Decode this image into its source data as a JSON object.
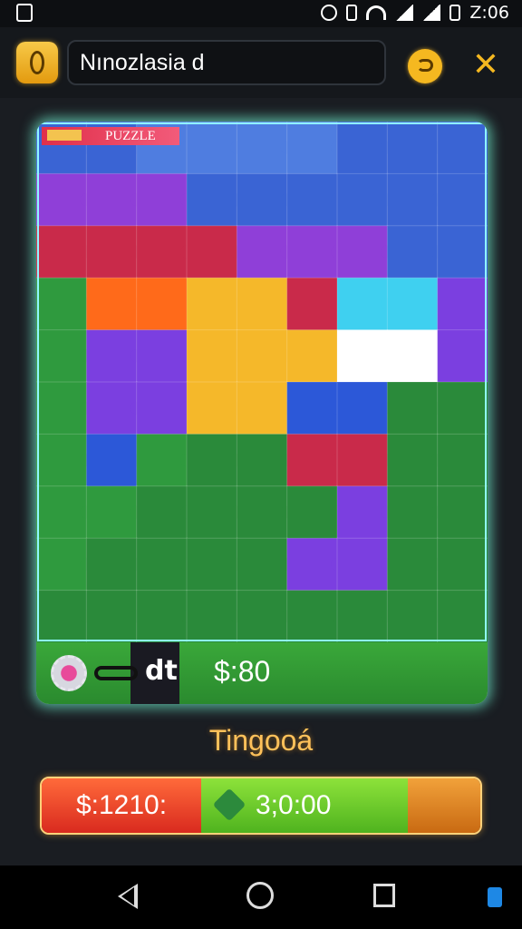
{
  "status_bar": {
    "time": "Z:06"
  },
  "header": {
    "title": "Nınozlasia d"
  },
  "board": {
    "tab_label": "PUZZLE",
    "footer": {
      "chain_text": "dt",
      "score": "$:80"
    },
    "colors": [
      "#4f7de0",
      "#3a64d4",
      "#8f3fd8",
      "#c92a4a",
      "#2f9a3e",
      "#ff6a1a",
      "#f5b82a",
      "#3fd0f0",
      "#ffffff",
      "#7b3fe0",
      "#2c58d8",
      "#2a8a3a",
      "#4fb8e8",
      "#6a32c8"
    ]
  },
  "caption": "Tingooá",
  "action_bar": {
    "left_value": "$:1210:",
    "middle_value": "3;0:00"
  },
  "icons": [
    "logo-icon",
    "coin-icon",
    "tools-icon",
    "gear-icon",
    "chain-icon",
    "leaf-icon",
    "play-icon",
    "back-icon",
    "home-icon",
    "recent-icon"
  ]
}
